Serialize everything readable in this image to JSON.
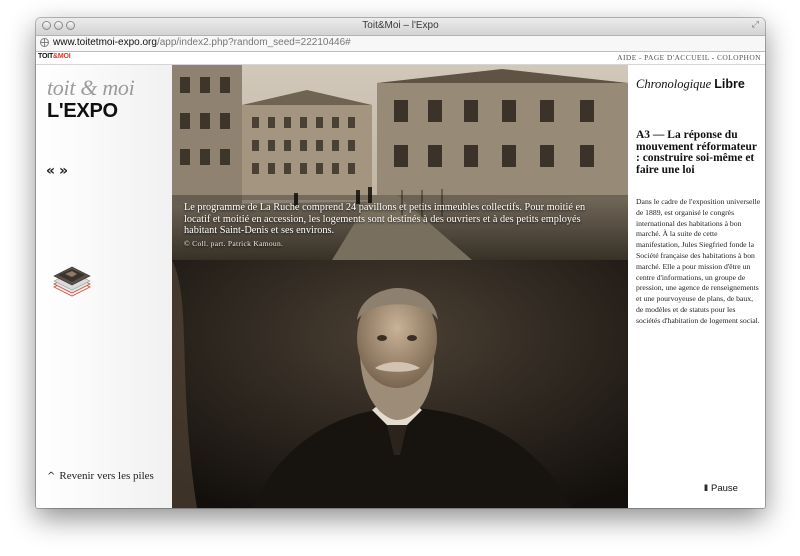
{
  "browser": {
    "title": "Toit&Moi – l'Expo",
    "url_host": "www.toitetmoi-expo.org",
    "url_path": "/app/index2.php?random_seed=22210446#"
  },
  "site": {
    "logo_part1": "TOIT",
    "logo_part2": "&MOI",
    "nav_aide": "AIDE",
    "nav_separator": " - ",
    "nav_accueil": "PAGE D'ACCUEIL",
    "nav_colophon": "COLOPHON"
  },
  "left": {
    "brand_sub": "toit & moi",
    "brand_main": "L'EXPO",
    "prev_symbol": "«",
    "next_symbol": "»",
    "back_chevron": "^",
    "back_label": "Revenir vers les piles"
  },
  "photo": {
    "caption": "Le programme de La Ruche comprend 24 pavillons et petits immeubles collectifs. Pour moitié en locatif et moitié en accession, les logements sont destinés à des ouvriers et à des petits employés habitant Saint-Denis et ses environs.",
    "credit": "© Coll. part. Patrick Kamoun."
  },
  "right": {
    "mode_chrono": "Chronologique",
    "mode_libre": "Libre",
    "title": "A3 — La réponse du mouvement réformateur : construire soi-même et faire une loi",
    "body": "Dans le cadre de l'exposition universelle de 1889, est organisé le congrès international des habitations à bon marché. À la suite de cette manifestation, Jules Siegfried fonde la Société française des habitations à bon marché. Elle a pour mission d'être un centre d'informations, un groupe de pression, une agence de renseignements et une pourvoyeuse de plans, de baux, de modèles et de statuts pour les sociétés d'habitation de logement social.",
    "pause_icon": "II",
    "pause_label": "Pause"
  },
  "colors": {
    "logo_accent": "#d33b2e",
    "photo_sepia": "#8a7a64"
  }
}
